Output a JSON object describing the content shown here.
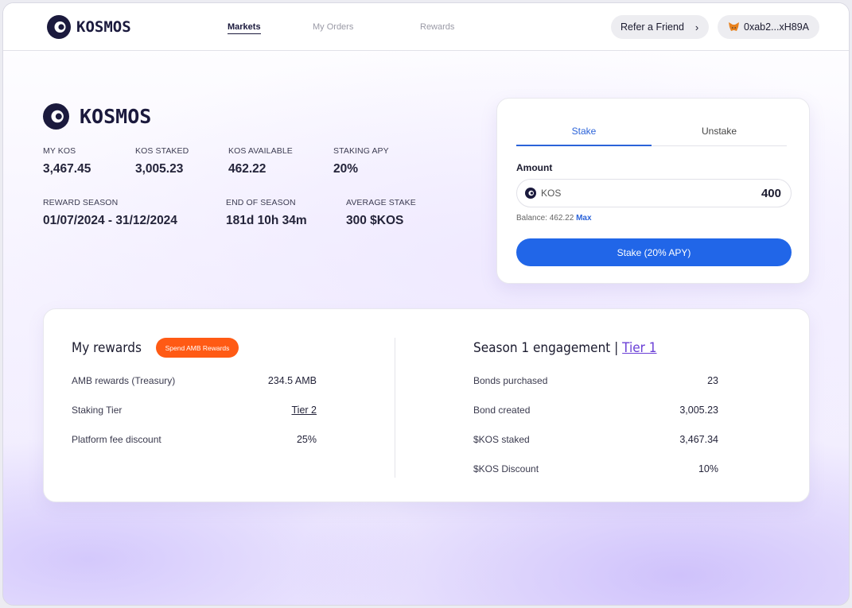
{
  "header": {
    "brand": "KOSMOS",
    "nav": [
      {
        "label": "Markets",
        "active": true
      },
      {
        "label": "My Orders",
        "active": false
      },
      {
        "label": "Rewards",
        "active": false
      }
    ],
    "refer_label": "Refer a Friend",
    "wallet_address": "0xab2...xH89A"
  },
  "token": {
    "name": "KOSMOS",
    "stats_row1": [
      {
        "label": "MY KOS",
        "value": "3,467.45"
      },
      {
        "label": "KOS STAKED",
        "value": "3,005.23"
      },
      {
        "label": "KOS AVAILABLE",
        "value": "462.22"
      },
      {
        "label": "STAKING APY",
        "value": "20%"
      }
    ],
    "stats_row2": [
      {
        "label": "REWARD SEASON",
        "value": "01/07/2024 - 31/12/2024"
      },
      {
        "label": "END OF SEASON",
        "value": "181d 10h 34m"
      },
      {
        "label": "AVERAGE STAKE",
        "value": "300 $KOS"
      }
    ]
  },
  "stake": {
    "tabs": [
      "Stake",
      "Unstake"
    ],
    "active_tab": "Stake",
    "amount_label": "Amount",
    "token_symbol": "KOS",
    "amount_value": "400",
    "balance_text": "Balance: 462.22",
    "max_label": "Max",
    "button_label": "Stake (20% APY)"
  },
  "rewards": {
    "title": "My rewards",
    "spend_button": "Spend AMB Rewards",
    "rows": [
      {
        "label": "AMB rewards (Treasury)",
        "value": "234.5 AMB"
      },
      {
        "label": "Staking Tier",
        "value": "Tier 2"
      },
      {
        "label": "Platform fee discount",
        "value": "25%"
      }
    ]
  },
  "engagement": {
    "title": "Season 1 engagement |",
    "tier_link": "Tier 1",
    "rows": [
      {
        "label": "Bonds purchased",
        "value": "23"
      },
      {
        "label": "Bond created",
        "value": "3,005.23"
      },
      {
        "label": "$KOS staked",
        "value": "3,467.34"
      },
      {
        "label": "$KOS Discount",
        "value": "10%"
      }
    ]
  },
  "colors": {
    "accent_blue": "#2166e8",
    "badge_orange": "#ff5a14",
    "link_purple": "#6a3fd6",
    "brand_dark": "#1b1a3d"
  }
}
